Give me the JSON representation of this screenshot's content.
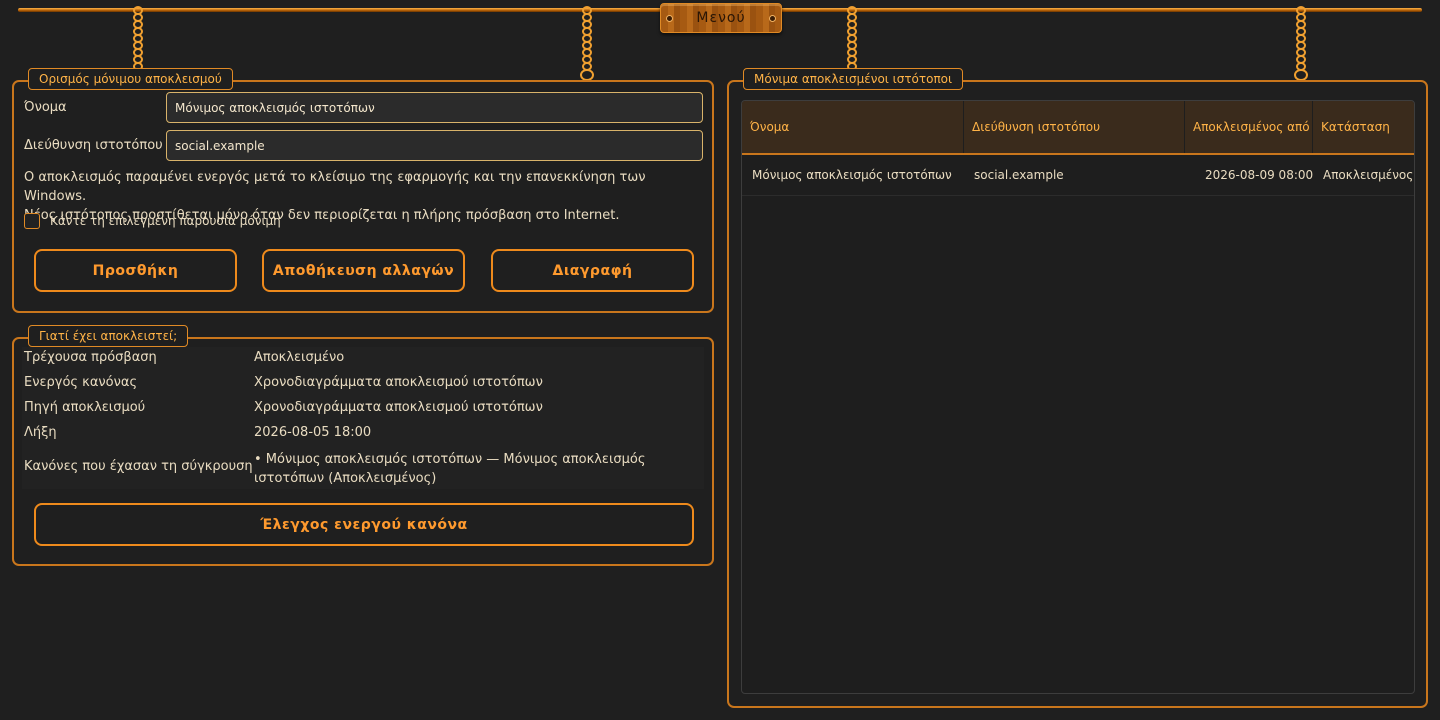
{
  "menu": {
    "label": "Μενού"
  },
  "permanent_block_form": {
    "legend": "Ορισμός μόνιμου αποκλεισμού",
    "name_label": "Όνομα",
    "name_value": "Μόνιμος αποκλεισμός ιστοτόπων",
    "url_label": "Διεύθυνση ιστοτόπου",
    "url_value": "social.example",
    "note_line1": "Ο αποκλεισμός παραμένει ενεργός μετά το κλείσιμο της εφαρμογής και την επανεκκίνηση των Windows.",
    "note_line2": "Νέος ιστότοπος προστίθεται μόνο όταν δεν περιορίζεται η πλήρης πρόσβαση στο Internet.",
    "checkbox_label": "Κάντε τη επιλεγμένη παρουσία μόνιμη",
    "add_button": "Προσθήκη",
    "save_button": "Αποθήκευση αλλαγών",
    "delete_button": "Διαγραφή"
  },
  "why_blocked": {
    "legend": "Γιατί έχει αποκλειστεί;",
    "rows": [
      {
        "key": "Τρέχουσα πρόσβαση",
        "value": "Αποκλεισμένο"
      },
      {
        "key": "Ενεργός κανόνας",
        "value": "Χρονοδιαγράμματα αποκλεισμού ιστοτόπων"
      },
      {
        "key": "Πηγή αποκλεισμού",
        "value": "Χρονοδιαγράμματα αποκλεισμού ιστοτόπων"
      },
      {
        "key": "Λήξη",
        "value": "2026-08-05 18:00"
      },
      {
        "key": "Κανόνες που έχασαν τη σύγκρουση",
        "value": "• Μόνιμος αποκλεισμός ιστοτόπων — Μόνιμος αποκλεισμός ιστοτόπων (Αποκλεισμένος)"
      }
    ],
    "check_button": "Έλεγχος ενεργού κανόνα"
  },
  "blocked_sites": {
    "legend": "Μόνιμα αποκλεισμένοι ιστότοποι",
    "columns": [
      "Όνομα",
      "Διεύθυνση ιστοτόπου",
      "Αποκλεισμένος από",
      "Κατάσταση"
    ],
    "rows": [
      [
        "Μόνιμος αποκλεισμός ιστοτόπων",
        "social.example",
        "2026-08-09 08:00",
        "Αποκλεισμένος"
      ]
    ]
  },
  "colors": {
    "accent": "#ee8a1c",
    "legend_text": "#ffb347",
    "background": "#1f1f1f"
  }
}
